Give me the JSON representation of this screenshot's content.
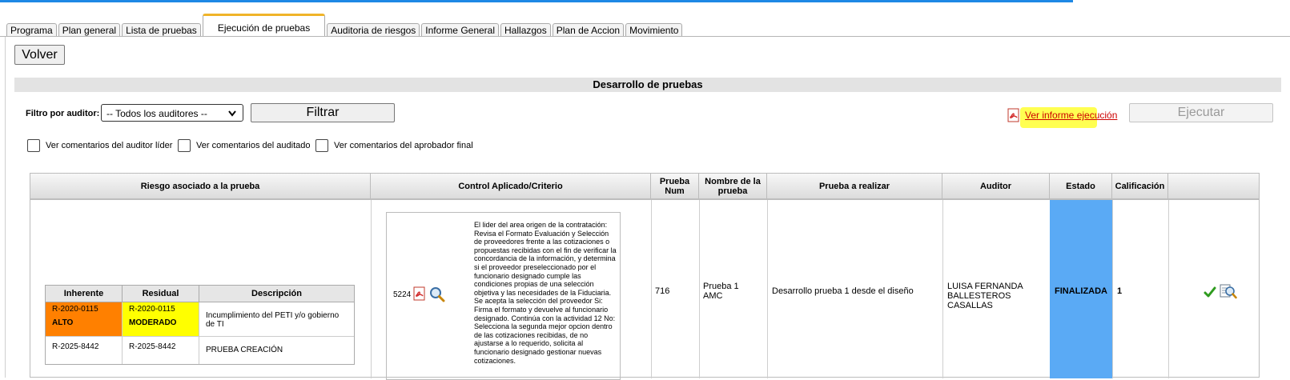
{
  "tabs": [
    {
      "label": "Programa"
    },
    {
      "label": "Plan general"
    },
    {
      "label": "Lista de pruebas"
    },
    {
      "label": "Ejecución de pruebas",
      "active": true
    },
    {
      "label": "Auditoria de riesgos"
    },
    {
      "label": "Informe General"
    },
    {
      "label": "Hallazgos"
    },
    {
      "label": "Plan de Accion"
    },
    {
      "label": "Movimiento"
    }
  ],
  "volver_label": "Volver",
  "section_title": "Desarrollo de pruebas",
  "filter": {
    "label": "Filtro por auditor:",
    "selected": "-- Todos los auditores --",
    "button": "Filtrar"
  },
  "ver_informe": "Ver informe ejecución",
  "ejecutar_label": "Ejecutar",
  "checkboxes": [
    {
      "label": "Ver comentarios del auditor líder"
    },
    {
      "label": "Ver comentarios del auditado"
    },
    {
      "label": "Ver comentarios del aprobador final"
    }
  ],
  "columns": [
    "Riesgo asociado a la prueba",
    "Control Aplicado/Criterio",
    "Prueba Num",
    "Nombre de la prueba",
    "Prueba a realizar",
    "Auditor",
    "Estado",
    "Calificación",
    ""
  ],
  "risk_table": {
    "headers": [
      "Inherente",
      "Residual",
      "Descripción"
    ],
    "rows": [
      {
        "inherente": "R-2020-0115",
        "inherente_level": "ALTO",
        "residual": "R-2020-0115",
        "residual_level": "MODERADO",
        "descripcion": "Incumplimiento del PETI y/o gobierno de TI"
      },
      {
        "inherente": "R-2025-8442",
        "residual": "R-2025-8442",
        "descripcion": "PRUEBA CREACIÓN"
      }
    ]
  },
  "control": {
    "id": "5224",
    "text": "El lider del area origen de la contratación: Revisa el Formato Evaluación y Selección de proveedores frente a las cotizaciones o propuestas recibidas con el fin de verificar la concordancia de la información, y determina si el proveedor preseleccionado por el funcionario designado cumple las condiciones propias de una selección objetiva y las necesidades de la Fiduciaria. Se acepta la selección del proveedor Si: Firma el formato y devuelve al funcionario designado. Continúa con la actividad 12 No: Selecciona la segunda mejor opcion dentro de las cotizaciones recibidas, de no ajustarse a lo requerido, solicita al funcionario designado gestionar nuevas cotizaciones."
  },
  "row": {
    "prueba_num": "716",
    "nombre": "Prueba 1 AMC",
    "prueba_realizar": "Desarrollo prueba 1 desde el diseño",
    "auditor": "LUISA FERNANDA BALLESTEROS CASALLAS",
    "estado": "FINALIZADA",
    "calificacion": "1"
  },
  "colors": {
    "alto": "#ff8000",
    "moderado": "#ffff00",
    "estado": "#5aaaf5",
    "link": "#cc0000",
    "tab_accent": "#f0b429"
  }
}
